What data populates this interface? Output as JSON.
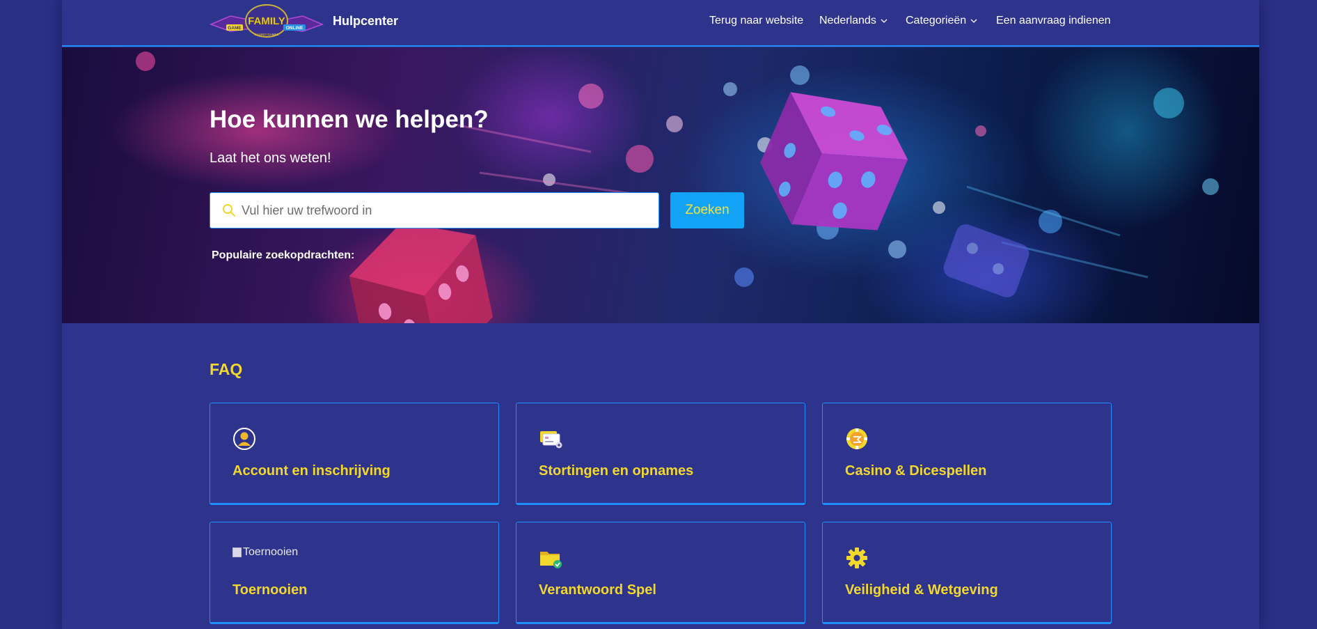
{
  "header": {
    "logo": {
      "word": "FAMILY",
      "left_tag": "GAME",
      "right_tag": "ONLINE",
      "bottom_tag": "CASINO GAMES"
    },
    "brand": "Hulpcenter",
    "nav": [
      {
        "label": "Terug naar website",
        "dropdown": false
      },
      {
        "label": "Nederlands",
        "dropdown": true
      },
      {
        "label": "Categorieën",
        "dropdown": true
      },
      {
        "label": "Een aanvraag indienen",
        "dropdown": false
      }
    ]
  },
  "hero": {
    "title": "Hoe kunnen we helpen?",
    "subtitle": "Laat het ons weten!",
    "search": {
      "placeholder": "Vul hier uw trefwoord in",
      "value": "",
      "button_label": "Zoeken"
    },
    "popular_label": "Populaire zoekopdrachten:"
  },
  "faq": {
    "title": "FAQ",
    "cards": [
      {
        "label": "Account en inschrijving",
        "icon": "user-icon"
      },
      {
        "label": "Stortingen en opnames",
        "icon": "credit-cards-icon"
      },
      {
        "label": "Casino & Dicespellen",
        "icon": "casino-chip-icon"
      },
      {
        "label": "Toernooien",
        "icon": "broken-image-icon",
        "alt": "Toernooien"
      },
      {
        "label": "Verantwoord Spel",
        "icon": "folder-check-icon"
      },
      {
        "label": "Veiligheid & Wetgeving",
        "icon": "gear-icon"
      }
    ]
  },
  "colors": {
    "background": "#2e338c",
    "accent_yellow": "#f2d82c",
    "accent_blue": "#1e90ff",
    "button_blue": "#12a3f7"
  }
}
